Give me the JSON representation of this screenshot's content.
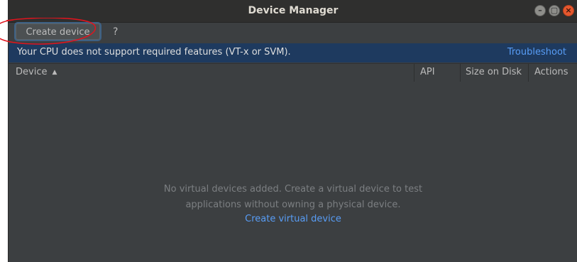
{
  "window": {
    "title": "Device Manager"
  },
  "toolbar": {
    "create_label": "Create device",
    "help_label": "?"
  },
  "banner": {
    "message": "Your CPU does not support required features (VT-x or SVM).",
    "link_label": "Troubleshoot"
  },
  "table": {
    "columns": {
      "device": "Device",
      "api": "API",
      "size": "Size on Disk",
      "actions": "Actions"
    },
    "sort_icon": "sort-ascending-icon"
  },
  "empty_state": {
    "line1": "No virtual devices added. Create a virtual device to test",
    "line2": "applications without owning a physical device.",
    "link_label": "Create virtual device"
  },
  "colors": {
    "banner_bg": "#1e3a5f",
    "link": "#589df6",
    "annotation": "#e0141e"
  }
}
